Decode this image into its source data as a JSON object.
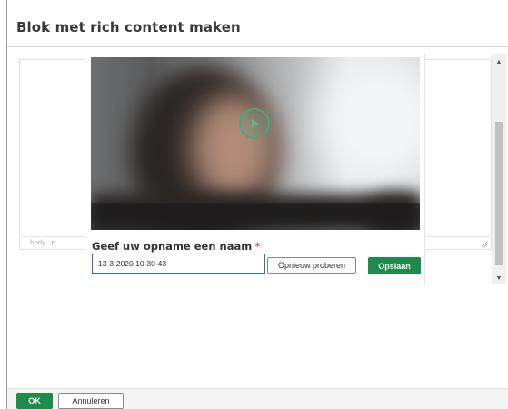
{
  "dialog": {
    "title": "Blok met rich content maken"
  },
  "editor": {
    "status_path": [
      "body",
      "p"
    ]
  },
  "recorder": {
    "name_label": "Geef uw opname een naam",
    "required_marker": "*",
    "name_value": "13-3-2020 10-30-43",
    "retry_label": "Opnieuw proberen",
    "save_label": "Opslaan",
    "play_icon": "play-icon"
  },
  "footer": {
    "ok_label": "OK",
    "cancel_label": "Annuleren"
  },
  "colors": {
    "accent_green": "#1e8a4c",
    "input_border": "#2f6db3",
    "required": "#d9534f"
  }
}
